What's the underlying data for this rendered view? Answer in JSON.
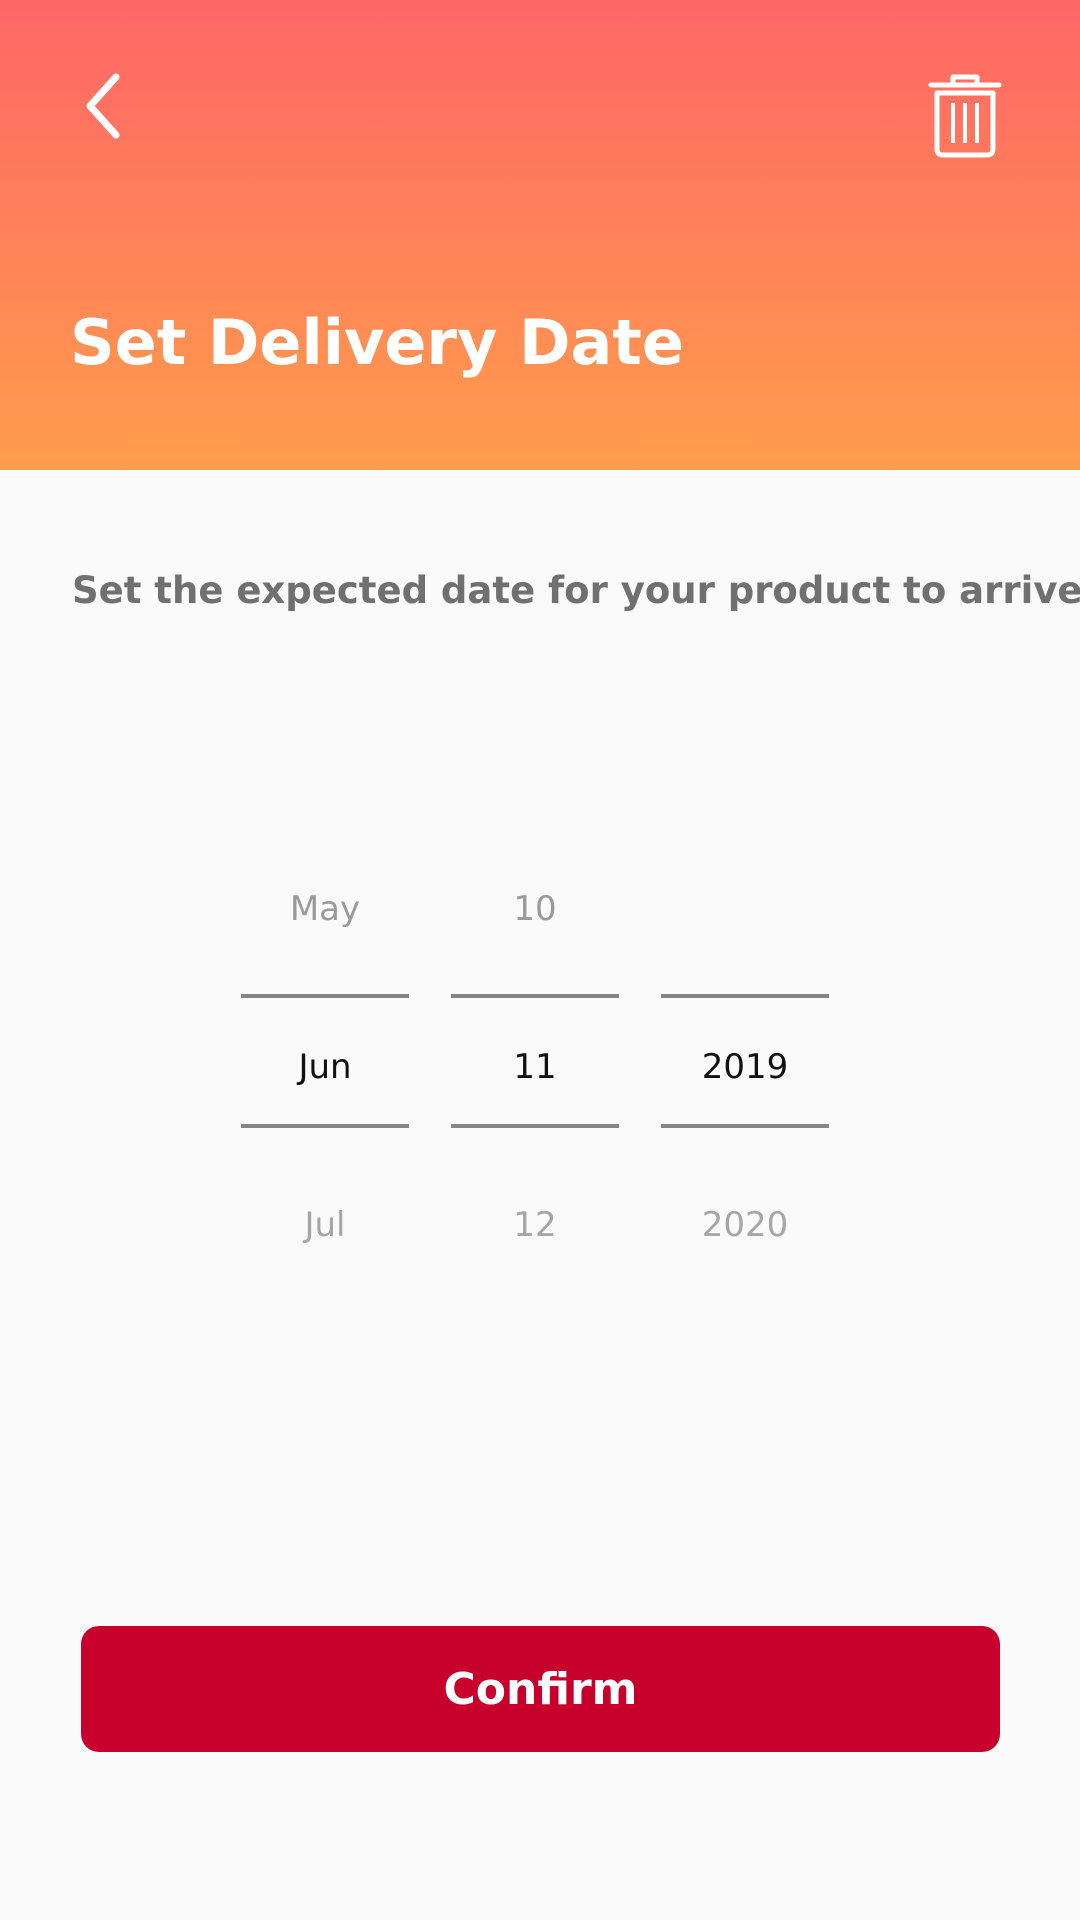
{
  "header": {
    "title": "Set Delivery Date",
    "back_icon": "chevron-left-icon",
    "delete_icon": "trash-icon"
  },
  "instruction": "Set the expected date for your product to arrive:",
  "date_picker": {
    "month": {
      "previous": "May",
      "selected": "Jun",
      "next": "Jul"
    },
    "day": {
      "previous": "10",
      "selected": "11",
      "next": "12"
    },
    "year": {
      "previous": "",
      "selected": "2019",
      "next": "2020"
    }
  },
  "confirm_label": "Confirm",
  "colors": {
    "header_gradient_top": "#ff6667",
    "header_gradient_bottom": "#ff9d4c",
    "confirm_button": "#c8002c",
    "background": "#fafafa",
    "instruction_text": "#707070",
    "divider": "#858585"
  }
}
